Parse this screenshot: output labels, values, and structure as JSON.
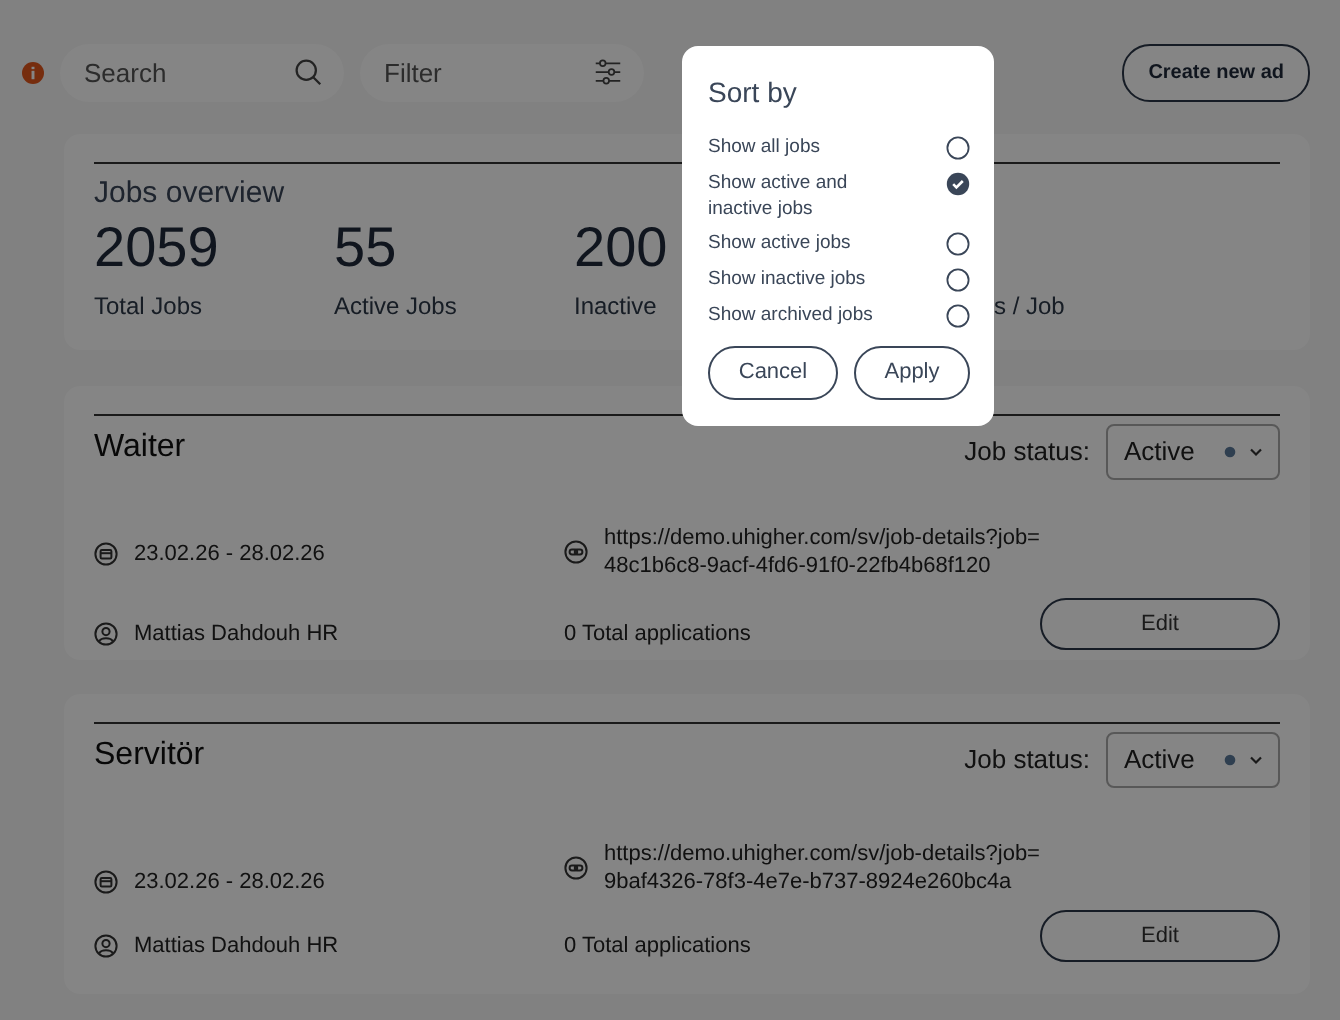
{
  "toolbar": {
    "alert": true,
    "search": {
      "placeholder": "Search"
    },
    "filter": {
      "placeholder": "Filter"
    },
    "create_button": "Create new ad"
  },
  "overview": {
    "title": "Jobs overview",
    "stats": [
      {
        "value": "2059",
        "label": "Total Jobs"
      },
      {
        "value": "55",
        "label": "Active Jobs"
      },
      {
        "value": "200",
        "label": "Inactive"
      },
      {
        "label": "s / Job"
      }
    ]
  },
  "jobs": [
    {
      "title": "Waiter",
      "status_label": "Job status:",
      "status": "Active",
      "dates": "23.02.26 - 28.02.26",
      "url": "https://demo.uhigher.com/sv/job-details?job=48c1b6c8-9acf-4fd6-91f0-22fb4b68f120",
      "owner": "Mattias Dahdouh HR",
      "applications": "0 Total applications",
      "edit": "Edit"
    },
    {
      "title": "Servitör",
      "status_label": "Job status:",
      "status": "Active",
      "dates": "23.02.26 - 28.02.26",
      "url": "https://demo.uhigher.com/sv/job-details?job=9baf4326-78f3-4e7e-b737-8924e260bc4a",
      "owner": "Mattias Dahdouh HR",
      "applications": "0 Total applications",
      "edit": "Edit"
    }
  ],
  "sort_dialog": {
    "title": "Sort by",
    "options": [
      {
        "label": "Show all jobs",
        "selected": false
      },
      {
        "label": "Show active and inactive jobs",
        "selected": true
      },
      {
        "label": "Show active jobs",
        "selected": false
      },
      {
        "label": "Show inactive jobs",
        "selected": false
      },
      {
        "label": "Show archived jobs",
        "selected": false
      }
    ],
    "buttons": [
      "Cancel",
      "Apply"
    ]
  }
}
